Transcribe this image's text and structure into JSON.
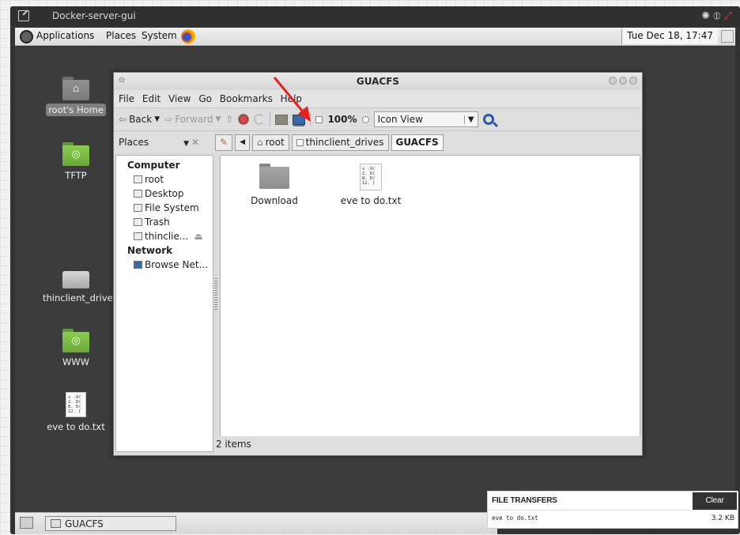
{
  "window": {
    "title": "Docker-server-gui"
  },
  "panel": {
    "applications": "Applications",
    "places": "Places",
    "system": "System",
    "clock": "Tue Dec 18, 17:47"
  },
  "desktop": {
    "icons": [
      {
        "label": "root's Home"
      },
      {
        "label": "TFTP"
      },
      {
        "label": "thinclient_drives"
      },
      {
        "label": "WWW"
      },
      {
        "label": "eve to do.txt"
      }
    ],
    "doc_preview": [
      "v .9(",
      "2. D(",
      "8. D(",
      "12. ["
    ]
  },
  "file_manager": {
    "title": "GUACFS",
    "menu": [
      "File",
      "Edit",
      "View",
      "Go",
      "Bookmarks",
      "Help"
    ],
    "toolbar": {
      "back": "Back",
      "forward": "Forward",
      "zoom": "100%",
      "view_mode": "Icon View"
    },
    "places_label": "Places",
    "breadcrumb": [
      "root",
      "thinclient_drives",
      "GUACFS"
    ],
    "sidebar": {
      "computer_header": "Computer",
      "computer_items": [
        "root",
        "Desktop",
        "File System",
        "Trash",
        "thinclie..."
      ],
      "network_header": "Network",
      "network_items": [
        "Browse Net..."
      ]
    },
    "files": [
      {
        "name": "Download",
        "icon": "folder-icon"
      },
      {
        "name": "eve to do.txt",
        "icon": "text-file-icon"
      }
    ],
    "status": "2 items"
  },
  "file_transfers": {
    "header": "FILE TRANSFERS",
    "clear_label": "Clear",
    "items": [
      {
        "name": "eve to do.txt",
        "size": "3.2 KB"
      }
    ]
  },
  "taskbar": {
    "task_label": "GUACFS"
  },
  "colors": {
    "annotation_arrow": "#e8211d",
    "transfer_clear_bg": "#333333"
  }
}
